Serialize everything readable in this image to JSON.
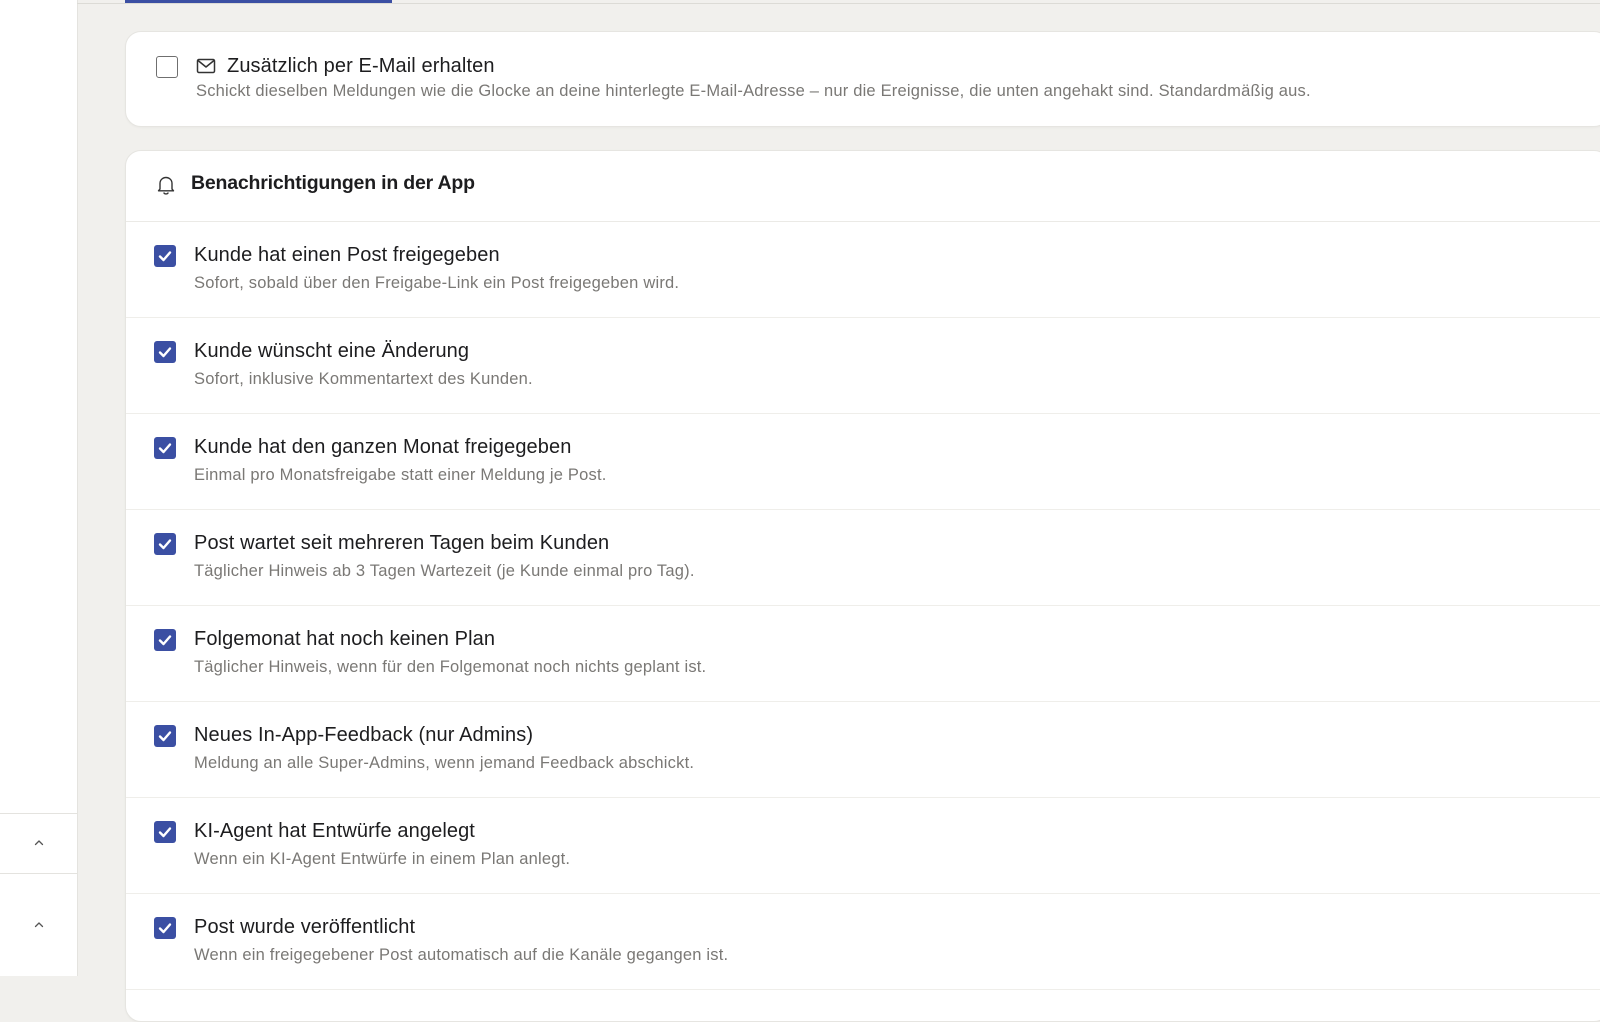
{
  "email_option": {
    "title": "Zusätzlich per E-Mail erhalten",
    "description": "Schickt dieselben Meldungen wie die Glocke an deine hinterlegte E-Mail-Adresse – nur die Ereignisse, die unten angehakt sind. Standardmäßig aus.",
    "checked": false,
    "icon": "mail-icon"
  },
  "app_section": {
    "title": "Benachrichtigungen in der App",
    "icon": "bell-icon",
    "items": [
      {
        "title": "Kunde hat einen Post freigegeben",
        "description": "Sofort, sobald über den Freigabe-Link ein Post freigegeben wird.",
        "checked": true
      },
      {
        "title": "Kunde wünscht eine Änderung",
        "description": "Sofort, inklusive Kommentartext des Kunden.",
        "checked": true
      },
      {
        "title": "Kunde hat den ganzen Monat freigegeben",
        "description": "Einmal pro Monatsfreigabe statt einer Meldung je Post.",
        "checked": true
      },
      {
        "title": "Post wartet seit mehreren Tagen beim Kunden",
        "description": "Täglicher Hinweis ab 3 Tagen Wartezeit (je Kunde einmal pro Tag).",
        "checked": true
      },
      {
        "title": "Folgemonat hat noch keinen Plan",
        "description": "Täglicher Hinweis, wenn für den Folgemonat noch nichts geplant ist.",
        "checked": true
      },
      {
        "title": "Neues In-App-Feedback (nur Admins)",
        "description": "Meldung an alle Super-Admins, wenn jemand Feedback abschickt.",
        "checked": true
      },
      {
        "title": "KI-Agent hat Entwürfe angelegt",
        "description": "Wenn ein KI-Agent Entwürfe in einem Plan anlegt.",
        "checked": true
      },
      {
        "title": "Post wurde veröffentlicht",
        "description": "Wenn ein freigegebener Post automatisch auf die Kanäle gegangen ist.",
        "checked": true
      }
    ]
  },
  "sidebar": {
    "collapse_buttons": [
      "chevron-up-icon",
      "chevron-up-icon"
    ]
  },
  "colors": {
    "accent": "#3b4fa3",
    "background": "#f1f0ed",
    "card": "#ffffff",
    "muted_text": "#7a7875"
  }
}
